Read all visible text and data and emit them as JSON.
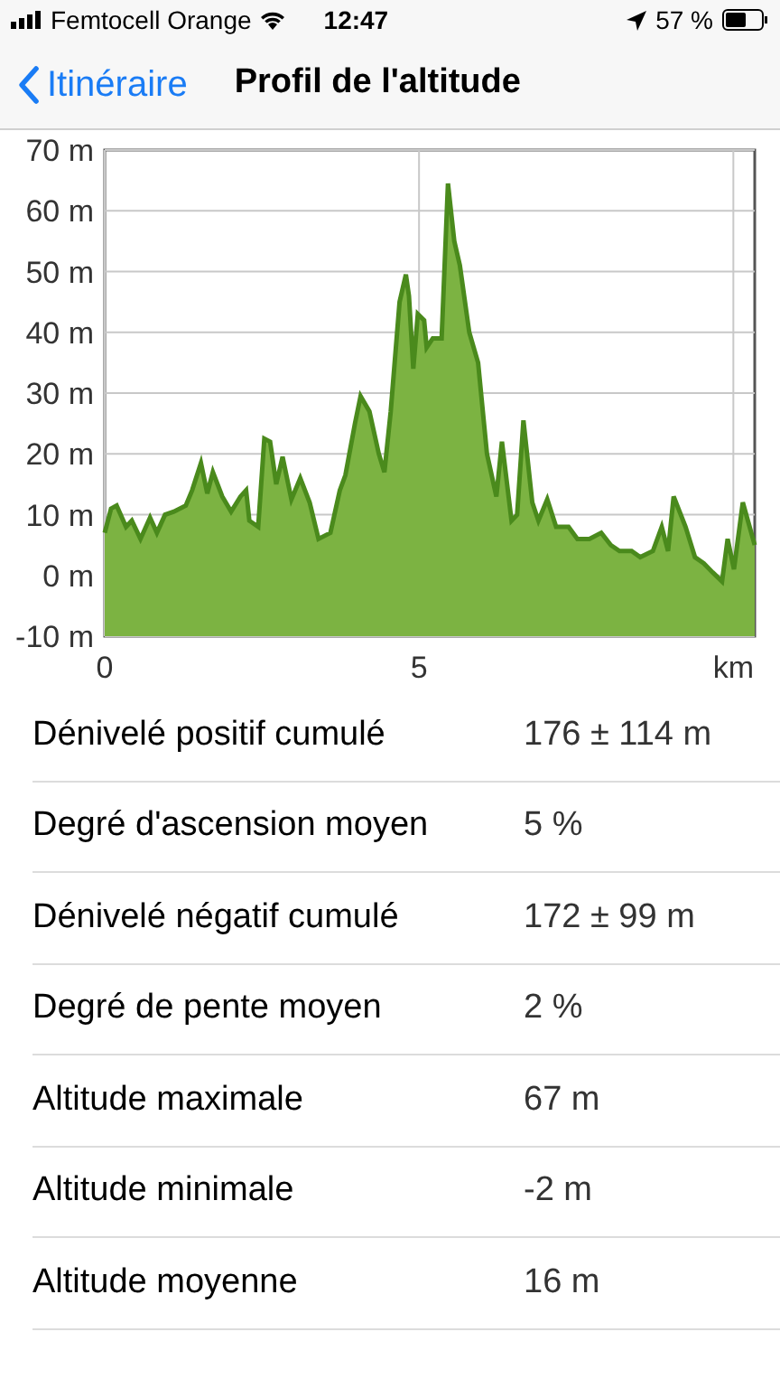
{
  "status_bar": {
    "carrier": "Femtocell Orange",
    "time": "12:47",
    "battery": "57 %"
  },
  "nav_bar": {
    "back": "Itinéraire",
    "title": "Profil de l'altitude"
  },
  "chart_data": {
    "type": "area",
    "xlim": [
      0,
      10.34
    ],
    "ylim": [
      -10,
      70
    ],
    "xticks": [
      0,
      5,
      {
        "value": 10,
        "label": "km"
      }
    ],
    "yticks": [
      {
        "value": 70,
        "label": "70 m"
      },
      {
        "value": 60,
        "label": "60 m"
      },
      {
        "value": 50,
        "label": "50 m"
      },
      {
        "value": 40,
        "label": "40 m"
      },
      {
        "value": 30,
        "label": "30 m"
      },
      {
        "value": 20,
        "label": "20 m"
      },
      {
        "value": 10,
        "label": "10 m"
      },
      {
        "value": 0,
        "label": "0 m"
      },
      {
        "value": -10,
        "label": "-10 m"
      }
    ],
    "x": [
      0,
      0.1,
      0.19,
      0.34,
      0.43,
      0.57,
      0.72,
      0.83,
      0.96,
      1.1,
      1.29,
      1.39,
      1.53,
      1.63,
      1.72,
      1.87,
      2.01,
      2.16,
      2.25,
      2.3,
      2.44,
      2.54,
      2.63,
      2.73,
      2.83,
      2.97,
      3.11,
      3.26,
      3.4,
      3.59,
      3.74,
      3.83,
      3.98,
      4.07,
      4.21,
      4.36,
      4.45,
      4.55,
      4.69,
      4.79,
      4.84,
      4.91,
      4.98,
      5.08,
      5.12,
      5.22,
      5.36,
      5.46,
      5.56,
      5.65,
      5.8,
      5.94,
      6.08,
      6.23,
      6.32,
      6.47,
      6.56,
      6.66,
      6.8,
      6.9,
      7.04,
      7.18,
      7.38,
      7.52,
      7.71,
      7.9,
      8.05,
      8.19,
      8.38,
      8.52,
      8.72,
      8.86,
      8.96,
      9.05,
      9.24,
      9.39,
      9.53,
      9.67,
      9.82,
      9.91,
      10.01,
      10.15,
      10.34
    ],
    "grid": true,
    "series": [
      {
        "color": "#7cb342",
        "values": [
          7,
          11,
          11.5,
          8,
          9,
          6,
          9.5,
          7,
          10,
          10.5,
          11.5,
          14,
          18.5,
          13.5,
          17,
          13,
          10.5,
          13,
          14,
          9,
          8,
          22.5,
          22,
          15,
          19.5,
          12.5,
          16,
          12,
          6,
          7,
          14,
          16.5,
          25,
          29.5,
          27,
          20,
          17,
          27,
          45,
          49.5,
          46,
          34,
          43,
          42,
          37.5,
          39,
          39,
          64.5,
          55,
          51,
          40,
          35,
          20,
          13,
          22,
          9,
          10,
          25.5,
          12,
          9,
          12.5,
          8,
          8,
          6,
          6,
          7,
          5,
          4,
          4,
          3,
          4,
          8,
          4,
          13,
          8,
          3,
          2,
          0.5,
          -1,
          6,
          1,
          12,
          5
        ]
      }
    ]
  },
  "stats": [
    {
      "label": "Dénivelé positif cumulé",
      "value": "176 ± 114 m"
    },
    {
      "label": "Degré d'ascension moyen",
      "value": "5 %"
    },
    {
      "label": "Dénivelé négatif cumulé",
      "value": "172 ± 99 m"
    },
    {
      "label": "Degré de pente moyen",
      "value": "2 %"
    },
    {
      "label": "Altitude maximale",
      "value": "67 m"
    },
    {
      "label": "Altitude minimale",
      "value": "-2 m"
    },
    {
      "label": "Altitude moyenne",
      "value": "16 m"
    }
  ]
}
